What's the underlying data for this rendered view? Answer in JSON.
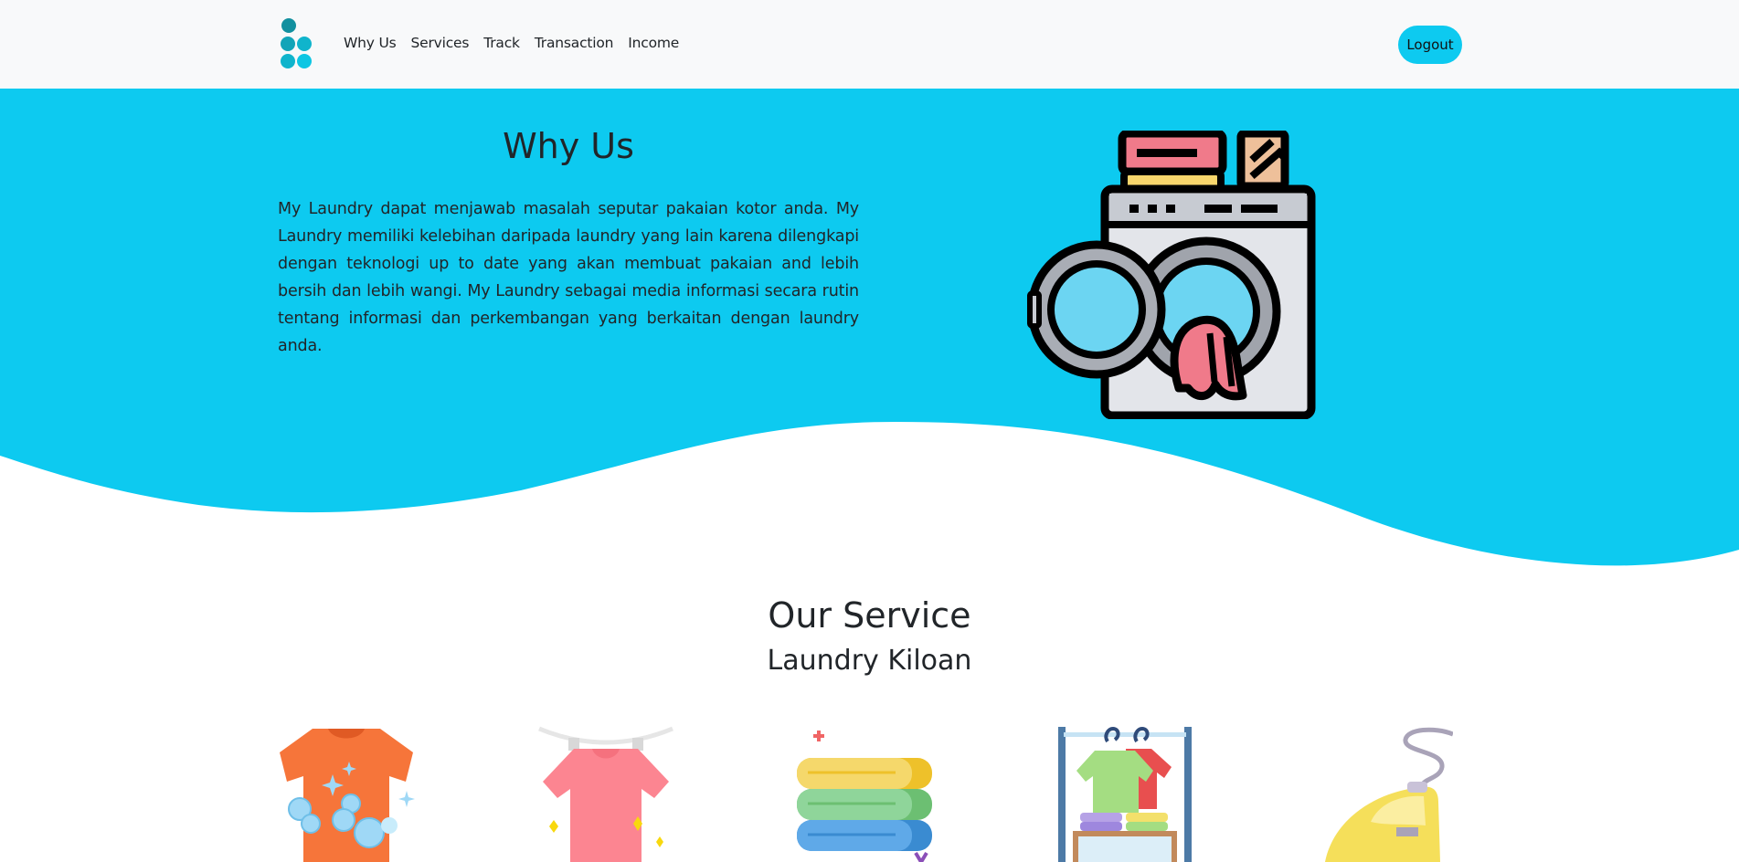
{
  "nav": {
    "links": [
      "Why Us",
      "Services",
      "Track",
      "Transaction",
      "Income"
    ],
    "logout_label": "Logout"
  },
  "hero": {
    "title": "Why Us",
    "text": "My Laundry dapat menjawab masalah seputar pakaian kotor anda. My Laundry memiliki kelebihan daripada laundry yang lain karena dilengkapi dengan teknologi up to date yang akan membuat pakaian and lebih bersih dan lebih wangi. My Laundry sebagai media informasi secara rutin tentang informasi dan perkembangan yang berkaitan dengan laundry anda."
  },
  "services": {
    "title": "Our Service",
    "subtitle": "Laundry Kiloan",
    "icons": [
      "washing-shirt-icon",
      "drying-shirt-icon",
      "folded-towels-icon",
      "clothes-rack-icon",
      "iron-icon"
    ]
  },
  "colors": {
    "accent": "#0dcaf0",
    "navbar_bg": "#f8f9fa",
    "logo": "#0e9fb0"
  }
}
